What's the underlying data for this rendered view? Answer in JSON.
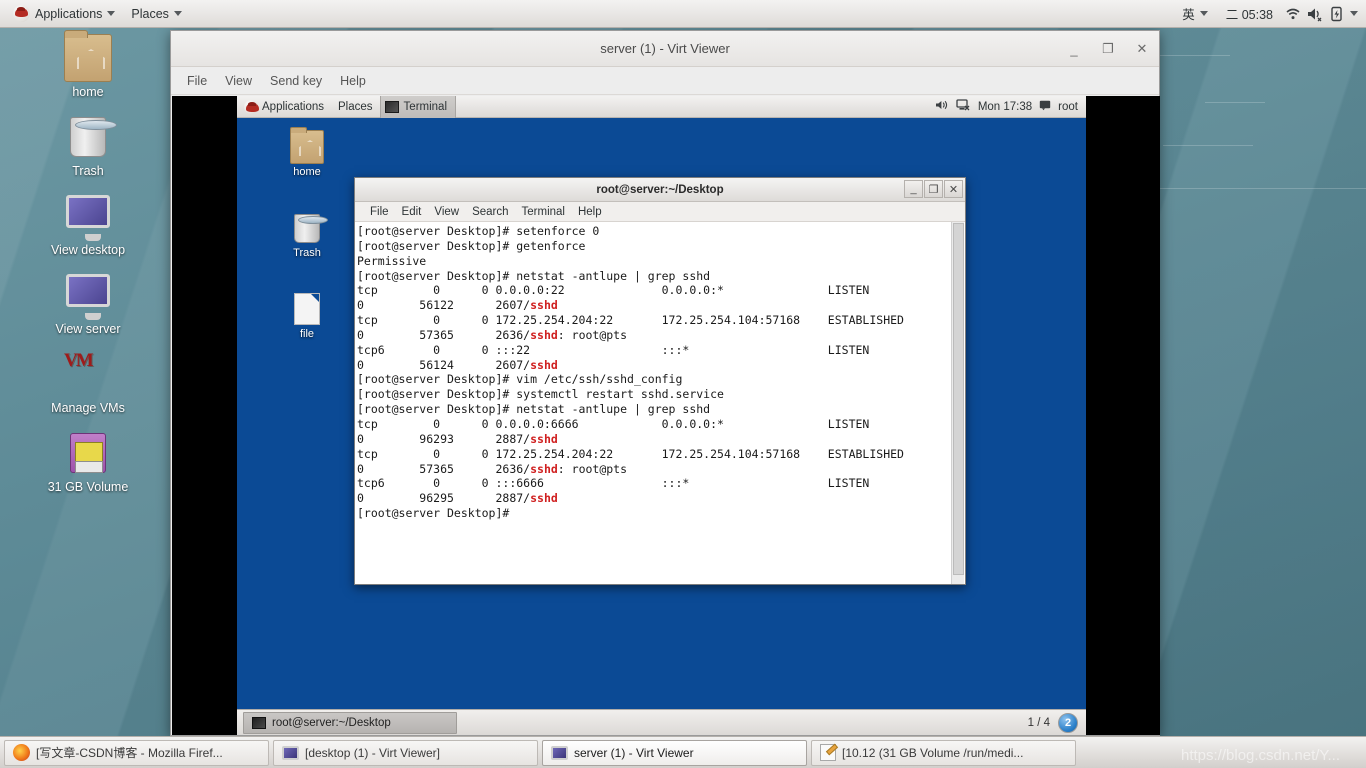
{
  "host_panel": {
    "logo_icon": "redhat-logo-icon",
    "applications_label": "Applications",
    "places_label": "Places",
    "input_method": "英",
    "clock": "二 05:38",
    "wifi_icon": "wifi-icon",
    "volume_icon": "volume-muted-icon",
    "battery_icon": "battery-charging-icon"
  },
  "desktop_icons": [
    {
      "label": "home",
      "icon": "folder-home-icon"
    },
    {
      "label": "Trash",
      "icon": "trash-icon"
    },
    {
      "label": "View desktop",
      "icon": "monitor-icon"
    },
    {
      "label": "View server",
      "icon": "monitor-icon"
    },
    {
      "label": "Manage VMs",
      "icon": "virt-manager-icon"
    },
    {
      "label": "31 GB Volume",
      "icon": "removable-drive-icon"
    }
  ],
  "virt_viewer": {
    "title": "server (1) - Virt Viewer",
    "minimize": "_",
    "maximize": "❐",
    "close": "✕",
    "menu": [
      "File",
      "View",
      "Send key",
      "Help"
    ]
  },
  "guest": {
    "panel": {
      "logo_icon": "redhat-logo-icon",
      "applications_label": "Applications",
      "places_label": "Places",
      "active_window": "Terminal",
      "volume_icon": "volume-icon",
      "network_icon": "network-disconnected-icon",
      "clock": "Mon 17:38",
      "user_icon": "user-icon",
      "user_label": "root"
    },
    "desktop_icons": [
      {
        "label": "home",
        "icon": "folder-home-icon"
      },
      {
        "label": "Trash",
        "icon": "trash-icon"
      },
      {
        "label": "file",
        "icon": "text-file-icon"
      }
    ],
    "bottom_panel": {
      "task_label": "root@server:~/Desktop",
      "task_icon": "terminal-icon",
      "workspace_indicator": "1 / 4",
      "notification_count": "2"
    }
  },
  "terminal": {
    "title": "root@server:~/Desktop",
    "minimize": "_",
    "maximize": "❐",
    "close": "✕",
    "menu": [
      "File",
      "Edit",
      "View",
      "Search",
      "Terminal",
      "Help"
    ],
    "lines": [
      [
        {
          "t": "[root@server Desktop]# setenforce 0"
        }
      ],
      [
        {
          "t": "[root@server Desktop]# getenforce"
        }
      ],
      [
        {
          "t": "Permissive"
        }
      ],
      [
        {
          "t": "[root@server Desktop]# netstat -antlupe | grep sshd"
        }
      ],
      [
        {
          "t": "tcp        0      0 0.0.0.0:22              0.0.0.0:*               LISTEN"
        }
      ],
      [
        {
          "t": "0        56122      2607/"
        },
        {
          "t": "sshd",
          "c": "hl"
        }
      ],
      [
        {
          "t": "tcp        0      0 172.25.254.204:22       172.25.254.104:57168    ESTABLISHED"
        }
      ],
      [
        {
          "t": "0        57365      2636/"
        },
        {
          "t": "sshd",
          "c": "hl"
        },
        {
          "t": ": root@pts"
        }
      ],
      [
        {
          "t": "tcp6       0      0 :::22                   :::*                    LISTEN"
        }
      ],
      [
        {
          "t": "0        56124      2607/"
        },
        {
          "t": "sshd",
          "c": "hl"
        }
      ],
      [
        {
          "t": "[root@server Desktop]# vim /etc/ssh/sshd_config"
        }
      ],
      [
        {
          "t": "[root@server Desktop]# systemctl restart sshd.service"
        }
      ],
      [
        {
          "t": "[root@server Desktop]# netstat -antlupe | grep sshd"
        }
      ],
      [
        {
          "t": "tcp        0      0 0.0.0.0:6666            0.0.0.0:*               LISTEN"
        }
      ],
      [
        {
          "t": "0        96293      2887/"
        },
        {
          "t": "sshd",
          "c": "hl"
        }
      ],
      [
        {
          "t": "tcp        0      0 172.25.254.204:22       172.25.254.104:57168    ESTABLISHED"
        }
      ],
      [
        {
          "t": "0        57365      2636/"
        },
        {
          "t": "sshd",
          "c": "hl"
        },
        {
          "t": ": root@pts"
        }
      ],
      [
        {
          "t": "tcp6       0      0 :::6666                 :::*                    LISTEN"
        }
      ],
      [
        {
          "t": "0        96295      2887/"
        },
        {
          "t": "sshd",
          "c": "hl"
        }
      ],
      [
        {
          "t": "[root@server Desktop]#"
        }
      ]
    ]
  },
  "taskbar": {
    "items": [
      {
        "label": "[写文章-CSDN博客 - Mozilla Firef...",
        "icon": "firefox-icon",
        "active": false
      },
      {
        "label": "[desktop (1) - Virt Viewer]",
        "icon": "monitor-icon",
        "active": false
      },
      {
        "label": "server (1) - Virt Viewer",
        "icon": "monitor-icon",
        "active": true
      },
      {
        "label": "[10.12 (31 GB Volume /run/medi...",
        "icon": "text-editor-icon",
        "active": false
      }
    ]
  },
  "watermark": "https://blog.csdn.net/Y..."
}
